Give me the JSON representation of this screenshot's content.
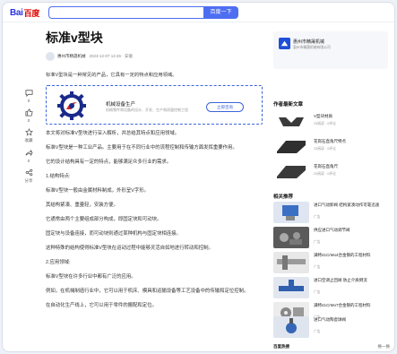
{
  "header": {
    "logo_bai": "Bai",
    "logo_du": "百度",
    "search_value": "",
    "search_button": "百度一下"
  },
  "leftbar": {
    "items": [
      {
        "icon": "comment-icon",
        "label": "0"
      },
      {
        "icon": "like-icon",
        "label": "0"
      },
      {
        "icon": "star-icon",
        "label": "收藏"
      },
      {
        "icon": "forward-icon",
        "label": "0"
      },
      {
        "icon": "share-icon",
        "label": "分享"
      }
    ]
  },
  "article": {
    "title": "标准v型块",
    "author": "惠州市精晟机械",
    "date": "2023-12-07 12:45 · 安徽",
    "intro": "标准V型块是一种常见的产品，它具有一定的特点和应用领域。",
    "ad": {
      "name": "机械设备生产",
      "sub": "机械零件和设备的设计、开发、生产和质量控制工程",
      "button": "立即咨询"
    },
    "paragraphs": [
      "本文将对标准V型块进行深入解析，并总结其特点和应用领域。",
      "标准V型块是一种工业产品。主要用于在不同行业中的流程控制和传输方面发挥重要作用。",
      "它的设计结构具有一定的特点，能够满足众多行业的需求。",
      "1.结构特点:",
      "标准V型块一般由金属材料制成，外形呈V字形。",
      "其结构紧凑、重量轻，安装方便。",
      "它通常由两个主要组成部分构成，即固定块和可动块。",
      "固定块与设备连接，而可动块则通过某种机构与固定块相连接。",
      "这种特殊的结构使得标准V型块在运动过程中能够灵活自如地进行转动和控制。",
      "2.应用领域:",
      "标准V型块在许多行业中都有广泛的应用。",
      "例如，在机械制造行业中，它可以用于机床、模具和运输设备等工艺设备中的传输和定位控制。",
      "在自动化生产线上，它可以用于零件的搬配和定位。"
    ]
  },
  "sidebar": {
    "company": {
      "name": "惠州市精晟机械",
      "address": "惠州市精晟机械有限公司"
    },
    "author_section_title": "作者最新文章",
    "author_articles": [
      {
        "name": "V型块材质",
        "reads": "23阅读 · 0评论"
      },
      {
        "name": "花岗石直角尺特点",
        "reads": "23阅读 · 0评论"
      },
      {
        "name": "花岗石直角尺",
        "reads": "20阅读 · 0评论"
      }
    ],
    "related_title": "相关推荐",
    "related": [
      {
        "name": "进口气动卸阀 结构紧凑动作可靠迅速",
        "src": "广告"
      },
      {
        "name": "供应进口气动调节阀",
        "src": "广告"
      },
      {
        "name": "满特41CrMo4合金钢的工程材料",
        "src": "广告"
      },
      {
        "name": "进口空调止回阀 防止介质倒流",
        "src": "广告"
      },
      {
        "name": "满特41CrMo7合金钢的工程材料",
        "src": "广告"
      },
      {
        "name": "进口气动陶瓷球阀",
        "src": "广告"
      }
    ],
    "footer_title": "百度热搜",
    "footer_swap": "换一换"
  }
}
